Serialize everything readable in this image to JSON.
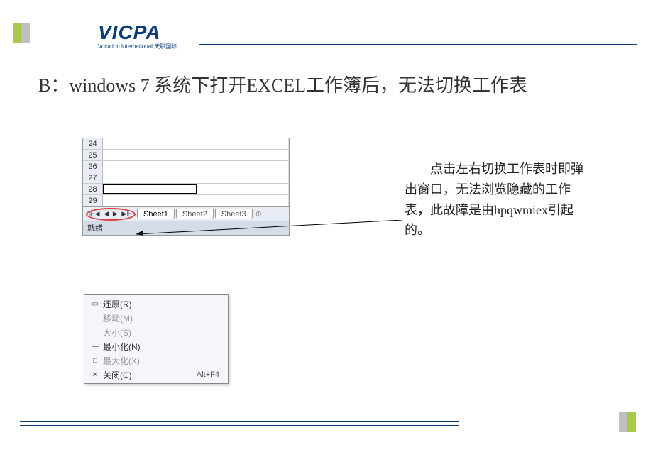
{
  "logo": {
    "main": "VICPA",
    "sub": "Vocation International",
    "sub_cn": "天职国际"
  },
  "title": "B：windows 7 系统下打开EXCEL工作簿后，无法切换工作表",
  "excel": {
    "rows": [
      "24",
      "25",
      "26",
      "27",
      "28",
      "29"
    ],
    "tabs": [
      "Sheet1",
      "Sheet2",
      "Sheet3"
    ],
    "status": "就绪",
    "nav": {
      "first": "⊩◀",
      "prev": "◀",
      "next": "▶",
      "last": "▶⊩"
    },
    "add_tab": "⊕"
  },
  "description": "点击左右切换工作表时即弹出窗口，无法浏览隐藏的工作表，此故障是由hpqwmiex引起的。",
  "menu": {
    "restore": {
      "icon": "▭",
      "label": "还原(R)"
    },
    "move": {
      "icon": "",
      "label": "移动(M)"
    },
    "size": {
      "icon": "",
      "label": "大小(S)"
    },
    "minimize": {
      "icon": "—",
      "label": "最小化(N)"
    },
    "maximize": {
      "icon": "□",
      "label": "最大化(X)"
    },
    "close": {
      "icon": "✕",
      "label": "关闭(C)",
      "shortcut": "Alt+F4"
    }
  }
}
